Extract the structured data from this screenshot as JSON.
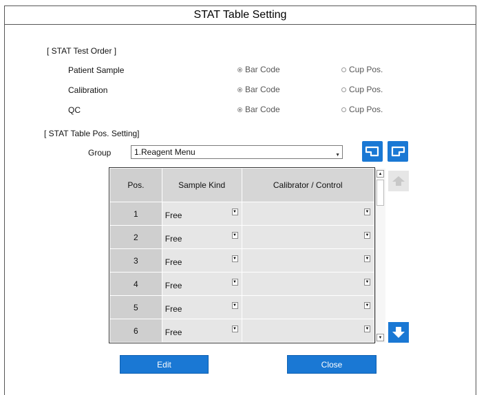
{
  "window": {
    "title": "STAT Table Setting"
  },
  "test_order": {
    "heading": "[ STAT Test Order ]",
    "rows": [
      {
        "label": "Patient Sample",
        "option_a": "Bar Code",
        "option_b": "Cup Pos.",
        "selected": "Bar Code"
      },
      {
        "label": "Calibration",
        "option_a": "Bar Code",
        "option_b": "Cup Pos.",
        "selected": "Bar Code"
      },
      {
        "label": "QC",
        "option_a": "Bar Code",
        "option_b": "Cup Pos.",
        "selected": "Bar Code"
      }
    ]
  },
  "pos_setting": {
    "heading": "[ STAT Table Pos. Setting]",
    "group_label": "Group",
    "group_value": "1.Reagent Menu"
  },
  "table": {
    "headers": [
      "Pos.",
      "Sample Kind",
      "Calibrator / Control"
    ],
    "rows": [
      {
        "pos": "1",
        "kind": "Free",
        "calibrator": ""
      },
      {
        "pos": "2",
        "kind": "Free",
        "calibrator": ""
      },
      {
        "pos": "3",
        "kind": "Free",
        "calibrator": ""
      },
      {
        "pos": "4",
        "kind": "Free",
        "calibrator": ""
      },
      {
        "pos": "5",
        "kind": "Free",
        "calibrator": ""
      },
      {
        "pos": "6",
        "kind": "Free",
        "calibrator": ""
      }
    ]
  },
  "buttons": {
    "edit": "Edit",
    "close": "Close"
  },
  "colors": {
    "accent": "#1a78d4",
    "disabled": "#c8c8c8"
  }
}
